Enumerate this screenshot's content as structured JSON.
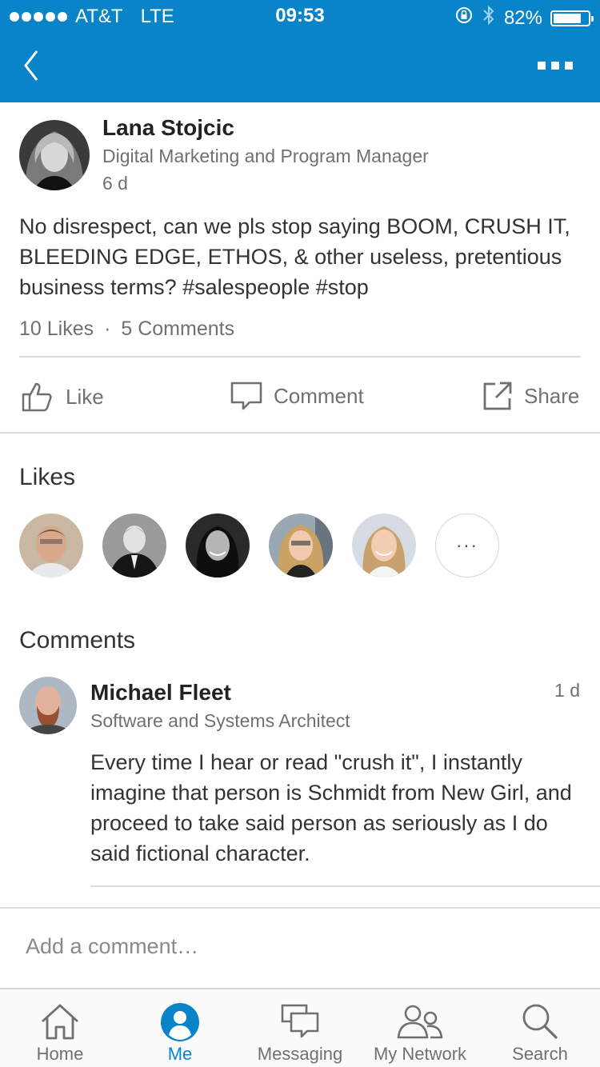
{
  "status_bar": {
    "carrier": "AT&T",
    "network": "LTE",
    "time": "09:53",
    "battery": "82%",
    "battery_level": 0.82
  },
  "post": {
    "author_name": "Lana Stojcic",
    "author_title": "Digital Marketing and Program Manager",
    "time_ago": "6 d",
    "text": "No disrespect, can we pls stop saying BOOM, CRUSH IT, BLEEDING EDGE, ETHOS, & other useless, pretentious business terms? #salespeople #stop",
    "likes_count": "10 Likes",
    "separator": "·",
    "comments_count": "5 Comments"
  },
  "actions": {
    "like": "Like",
    "comment": "Comment",
    "share": "Share"
  },
  "likes_section": {
    "title": "Likes",
    "more": "···"
  },
  "comments_section": {
    "title": "Comments",
    "items": [
      {
        "author_name": "Michael Fleet",
        "author_title": "Software and Systems Architect",
        "time_ago": "1 d",
        "text": "Every time I hear or read \"crush it\", I instantly imagine that person is Schmidt from New Girl, and proceed to take said person as seriously as I do said fictional character."
      }
    ]
  },
  "composer": {
    "placeholder": "Add a comment…"
  },
  "tabbar": {
    "tabs": [
      {
        "label": "Home",
        "icon": "home-icon"
      },
      {
        "label": "Me",
        "icon": "me-icon",
        "active": true
      },
      {
        "label": "Messaging",
        "icon": "messaging-icon"
      },
      {
        "label": "My Network",
        "icon": "network-icon"
      },
      {
        "label": "Search",
        "icon": "search-icon"
      }
    ]
  },
  "colors": {
    "brand": "#0a84c8",
    "text_primary": "#333333",
    "text_secondary": "#707070",
    "divider": "#dcdcdc"
  }
}
